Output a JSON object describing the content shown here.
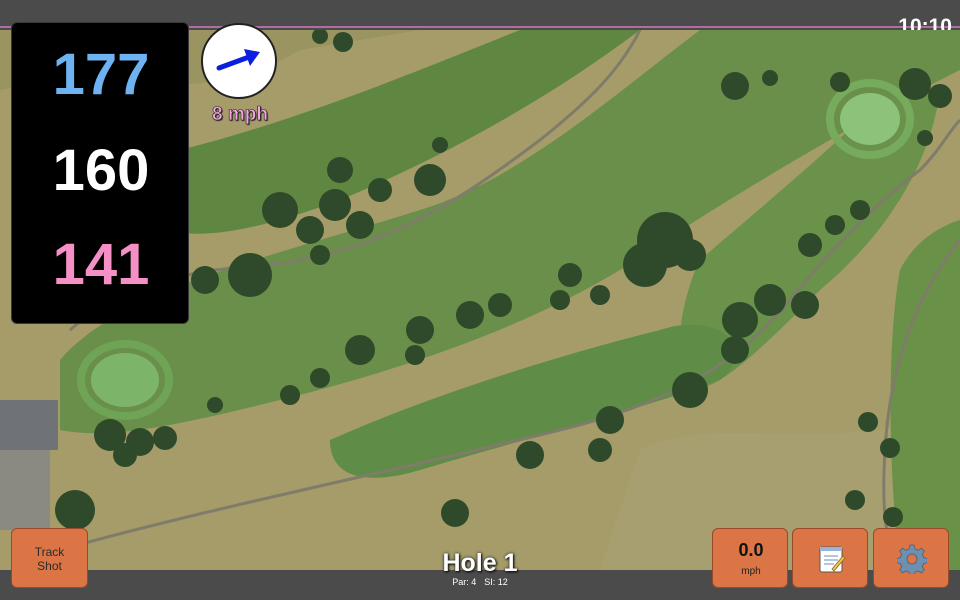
{
  "status_bar": {
    "time": "10:10"
  },
  "yardages": {
    "back": "177",
    "middle": "160",
    "front": "141"
  },
  "wind": {
    "speed_label": "8 mph",
    "direction": "east-northeast",
    "arrow_color": "#0a1fe0"
  },
  "hole": {
    "title": "Hole 1",
    "par_label": "Par: 4",
    "si_label": "SI: 12"
  },
  "buttons": {
    "track_shot_line1": "Track",
    "track_shot_line2": "Shot",
    "speed_value": "0.0",
    "speed_unit": "mph",
    "notes_icon": "notepad-icon",
    "settings_icon": "gear-icon"
  },
  "colors": {
    "back_yardage": "#6fb2f2",
    "middle_yardage": "#ffffff",
    "front_yardage": "#f490c6",
    "button_fill": "#db7545",
    "fairway": "#5f8a45",
    "rough": "#a39b69",
    "green": "#7cb56a"
  },
  "map": {
    "view": "satellite course map"
  }
}
